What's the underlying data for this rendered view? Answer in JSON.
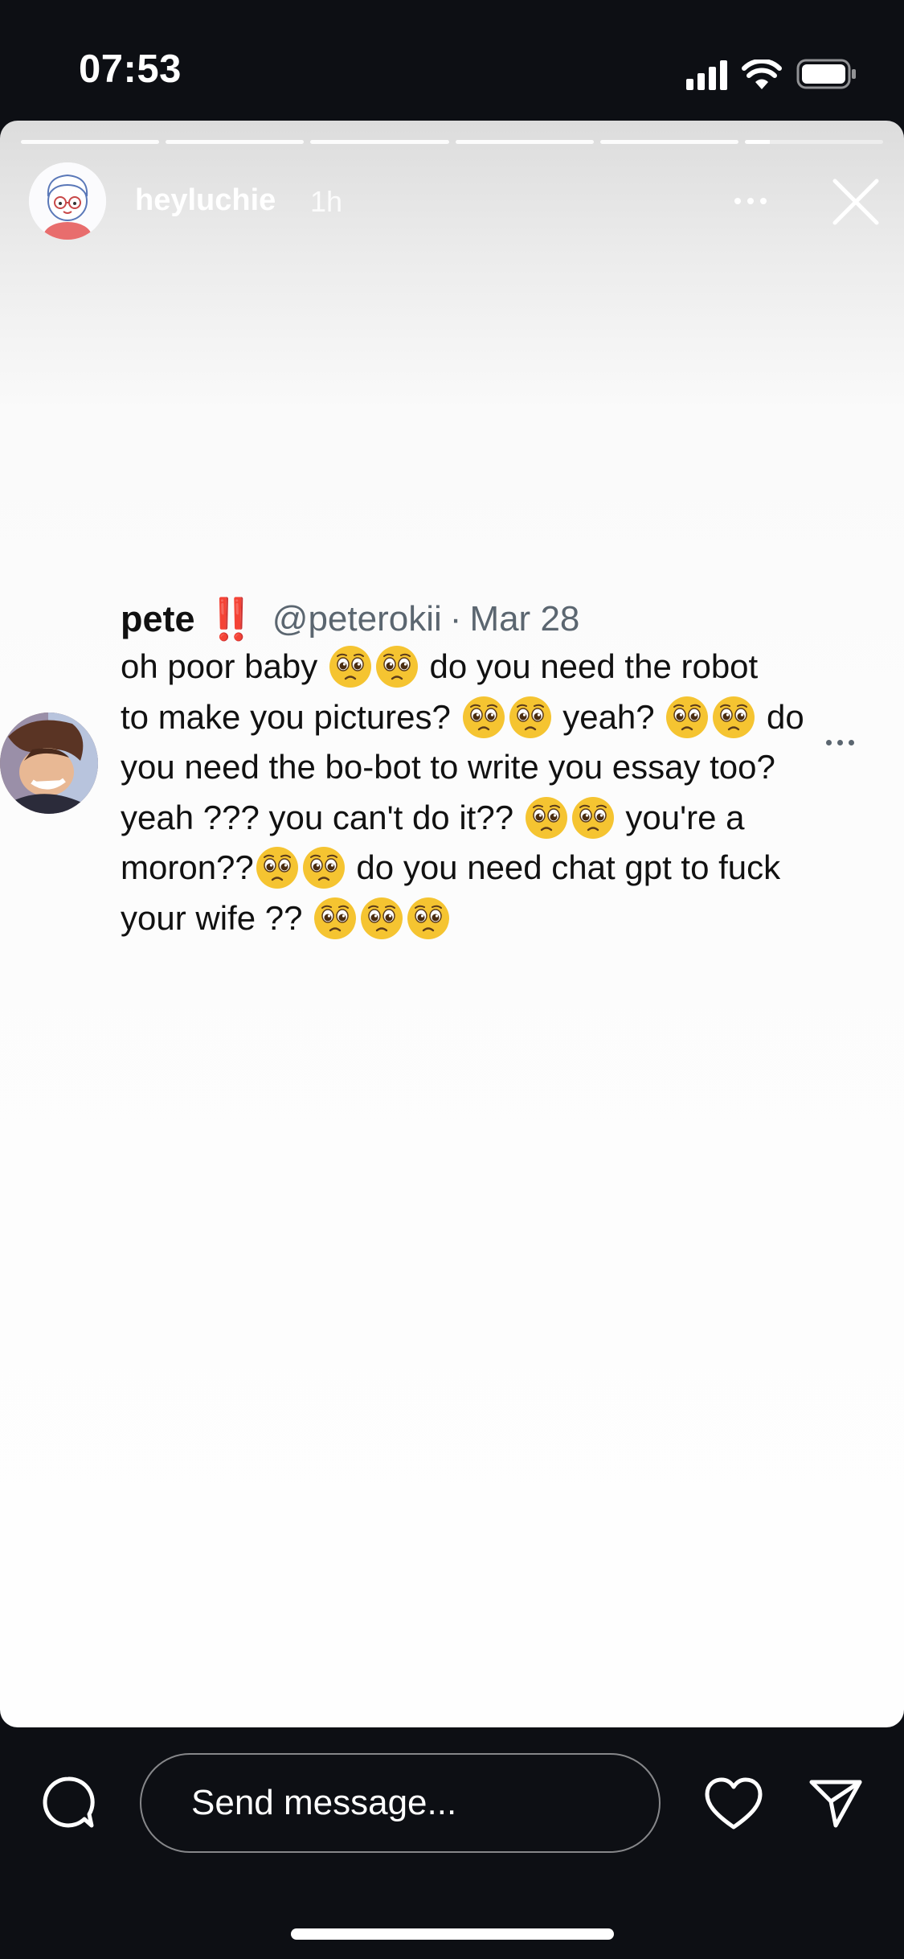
{
  "status_bar": {
    "time": "07:53",
    "icons": [
      "signal-icon",
      "wifi-icon",
      "battery-icon"
    ]
  },
  "story": {
    "progress_segments": 6,
    "current_segment_progress": 0.18,
    "username": "heyluchie",
    "posted_ago": "1h",
    "icons": [
      "more-icon",
      "close-icon"
    ]
  },
  "tweet": {
    "display_name": "pete",
    "name_badge": "‼️",
    "handle": "@peterokii",
    "separator": "·",
    "date": "Mar 28",
    "emoji": "pleading-face",
    "lines": [
      [
        "oh poor baby ",
        "🥺",
        "🥺",
        " do you need the robot"
      ],
      [
        "to make you pictures? ",
        "🥺",
        "🥺",
        " yeah? ",
        "🥺",
        "🥺",
        " do"
      ],
      [
        "you need the bo-bot to write you essay too?"
      ],
      [
        "yeah ??? you can't do it?? ",
        "🥺",
        "🥺",
        " you're a"
      ],
      [
        "moron??",
        "🥺",
        "🥺",
        " do you need chat gpt to fuck"
      ],
      [
        "your wife ?? ",
        "🥺",
        "🥺",
        "🥺"
      ]
    ]
  },
  "reply_bar": {
    "placeholder": "Send message...",
    "icons": [
      "comment-icon",
      "heart-icon",
      "share-icon"
    ]
  },
  "colors": {
    "background": "#0d0f14",
    "story_card": "#fefefe",
    "tweet_text": "#111111",
    "tweet_meta": "#5b6670",
    "badge_red": "#e02020",
    "emoji_yellow": "#f5c431"
  }
}
